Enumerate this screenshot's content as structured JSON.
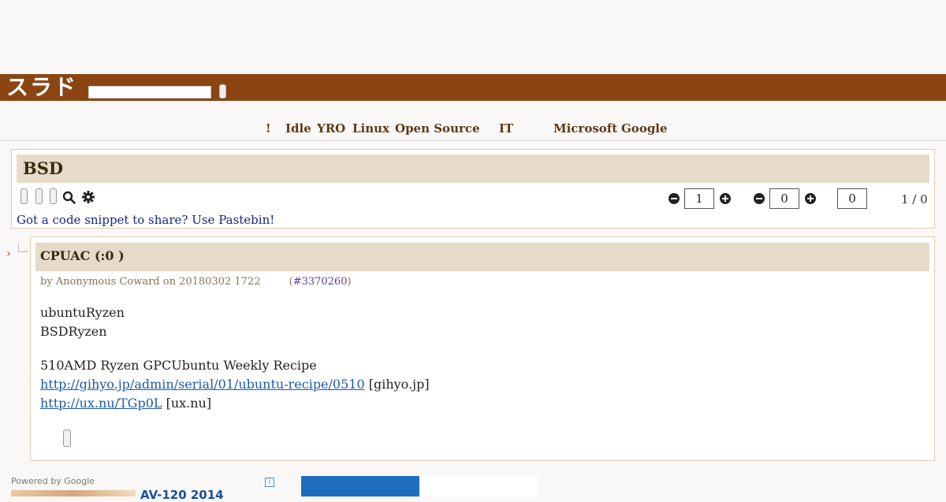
{
  "header": {
    "logo_text": "スラド",
    "search_placeholder": ""
  },
  "nav": {
    "items": [
      "!",
      "Idle",
      "YRO",
      "Linux",
      "Open Source",
      "IT",
      "Microsoft",
      "Google"
    ]
  },
  "story": {
    "title": "BSD",
    "score_value": "1",
    "threshold_value": "0",
    "extra_value": "0",
    "pager": "1 / 0",
    "pastebin_text": "Got a code snippet to share? Use Pastebin!"
  },
  "comment": {
    "title": "CPUAC (:0  )",
    "byline": "by Anonymous Coward on 20180302 1722",
    "comment_id": "#3370260",
    "line1": "ubuntuRyzen",
    "line2": "BSDRyzen",
    "line3": "510AMD Ryzen GPCUbuntu Weekly Recipe",
    "link1": "http://gihyo.jp/admin/serial/01/ubuntu-recipe/0510",
    "link1_domain": "[gihyo.jp]",
    "link2": "http://ux.nu/TGp0L",
    "link2_domain": "[ux.nu]"
  },
  "ads": {
    "powered_by": "Powered by Google",
    "ad_text": "AV-120 2014"
  }
}
